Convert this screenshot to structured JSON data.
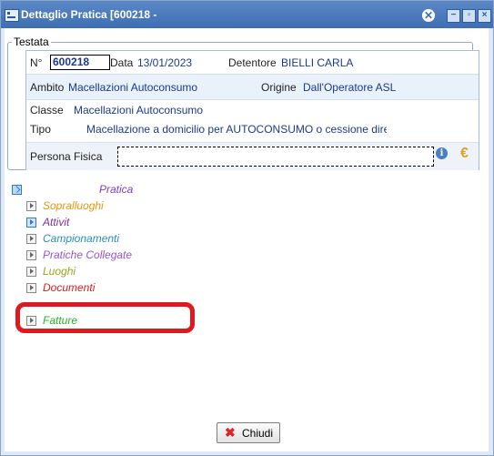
{
  "window": {
    "title": "Dettaglio Pratica [600218 -",
    "close_glyph": "✕",
    "minimize_glyph": "−",
    "restore_glyph": "▫",
    "close_btn_glyph": "×"
  },
  "testata": {
    "legend": "Testata",
    "numero_label": "N°",
    "numero_value": "600218",
    "data_label": "Data",
    "data_value": "13/01/2023",
    "detentore_label": "Detentore",
    "detentore_value": "BIELLI CARLA",
    "ambito_label": "Ambito",
    "ambito_value": "Macellazioni Autoconsumo",
    "origine_label": "Origine",
    "origine_value": "Dall'Operatore ASL",
    "classe_label": "Classe",
    "classe_value": "Macellazioni Autoconsumo",
    "tipo_label": "Tipo",
    "tipo_value": "Macellazione a domicilio per AUTOCONSUMO o cessione diretta",
    "persona_label": "Persona Fisica",
    "info_glyph": "i",
    "euro_glyph": "€"
  },
  "tree": {
    "root": "Pratica",
    "items": [
      {
        "label": "Sopralluoghi",
        "color": "#e8950c"
      },
      {
        "label": "Attivit",
        "color": "#7b2fa6"
      },
      {
        "label": "Campionamenti",
        "color": "#2a8fb7"
      },
      {
        "label": "Pratiche Collegate",
        "color": "#9a55c9"
      },
      {
        "label": "Luoghi",
        "color": "#9aa21c"
      },
      {
        "label": "Documenti",
        "color": "#d81e1e"
      },
      {
        "label": "Fatture",
        "color": "#24b52a"
      }
    ]
  },
  "buttons": {
    "chiudi_label": "Chiudi",
    "chiudi_glyph": "✖"
  },
  "colors": {
    "titlebar": "#4a7cbf",
    "highlight": "#e0191f",
    "value_text": "#1b3a8a"
  }
}
